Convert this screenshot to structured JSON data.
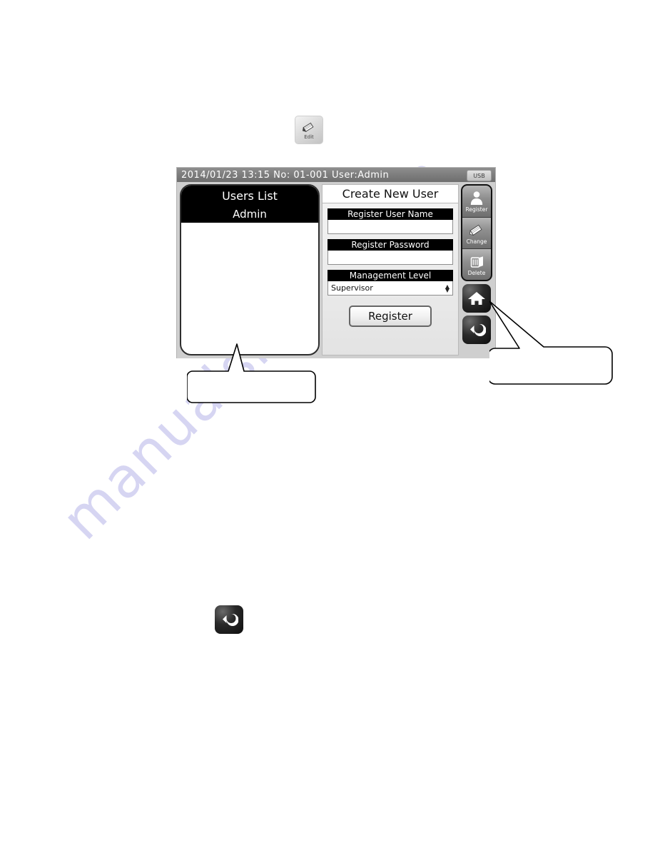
{
  "page": {
    "watermark_text": "manualshive.com"
  },
  "standalone_icons": {
    "edit": {
      "label": "Edit",
      "icon": "pencil-icon"
    },
    "back": {
      "label": "",
      "icon": "back-arrow-icon"
    }
  },
  "device": {
    "status_bar": {
      "date": "2014/01/23",
      "time": "13:15",
      "number_label": "No:",
      "number": "01-001",
      "user": "User:Admin",
      "full_text": "2014/01/23  13:15   No: 01-001   User:Admin",
      "usb_badge": "USB"
    },
    "users_panel": {
      "title": "Users List",
      "users": [
        "Admin"
      ]
    },
    "form_panel": {
      "title": "Create New User",
      "fields": [
        {
          "label": "Register User Name",
          "value": "",
          "type": "text"
        },
        {
          "label": "Register Password",
          "value": "",
          "type": "password"
        }
      ],
      "management_level": {
        "label": "Management Level",
        "value": "Supervisor",
        "options": [
          "Supervisor"
        ]
      },
      "submit_label": "Register"
    },
    "sidebar": {
      "group_buttons": [
        {
          "label": "Register",
          "icon": "person-icon"
        },
        {
          "label": "Change",
          "icon": "pencil-icon"
        },
        {
          "label": "Delete",
          "icon": "trash-icon"
        }
      ],
      "home_button": {
        "label": "",
        "icon": "home-icon"
      },
      "back_button": {
        "label": "",
        "icon": "back-arrow-icon"
      }
    }
  },
  "callouts": {
    "left": {
      "text": ""
    },
    "right": {
      "text": ""
    }
  },
  "colors": {
    "panel_black": "#000000",
    "status_gray": "#7d7d7d",
    "watermark": "#c9c8ee"
  }
}
